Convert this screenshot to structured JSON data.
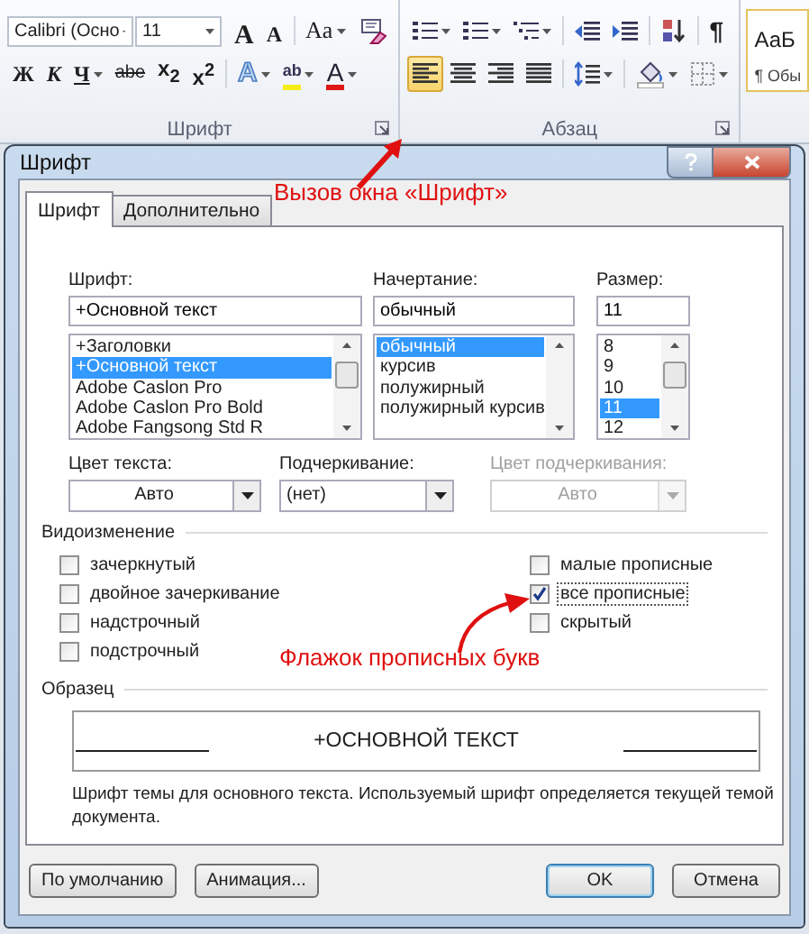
{
  "ribbon": {
    "font_group": {
      "label": "Шрифт",
      "font_name": "Calibri (Осно",
      "font_size": "11",
      "row1": [
        {
          "kind": "grow",
          "label": "A",
          "dropdown": false
        },
        {
          "kind": "shrink",
          "label": "A",
          "dropdown": false
        },
        {
          "kind": "case",
          "label": "Aa",
          "dropdown": true
        },
        {
          "kind": "clear",
          "dropdown": false
        }
      ],
      "row2": [
        {
          "kind": "bold",
          "label": "Ж",
          "dropdown": false
        },
        {
          "kind": "italic",
          "label": "К",
          "dropdown": false
        },
        {
          "kind": "underline",
          "label": "Ч",
          "dropdown": true
        },
        {
          "kind": "strike",
          "label": "abe",
          "dropdown": false
        },
        {
          "kind": "subscript",
          "label": "x$_{2}$",
          "dropdown": false
        },
        {
          "kind": "superscript",
          "label": "x$^{2}$",
          "dropdown": false
        },
        {
          "kind": "effects",
          "label": "A",
          "dropdown": true
        },
        {
          "kind": "highlight",
          "label": "ab",
          "dropdown": true
        },
        {
          "kind": "font-color",
          "label": "A",
          "dropdown": true
        }
      ]
    },
    "paragraph_group": {
      "label": "Абзац",
      "row1": [
        {
          "kind": "bullets",
          "dropdown": true
        },
        {
          "kind": "numbering",
          "dropdown": true
        },
        {
          "kind": "multilevel",
          "dropdown": true
        },
        {
          "kind": "outdent",
          "dropdown": false
        },
        {
          "kind": "indent",
          "dropdown": false
        },
        {
          "kind": "sort",
          "dropdown": false
        },
        {
          "kind": "pilcrow",
          "label": "¶",
          "dropdown": false
        }
      ],
      "row2": [
        {
          "kind": "align-left",
          "selected": true,
          "dropdown": false
        },
        {
          "kind": "align-center",
          "selected": false,
          "dropdown": false
        },
        {
          "kind": "align-right",
          "selected": false,
          "dropdown": false
        },
        {
          "kind": "justify",
          "selected": false,
          "dropdown": false
        },
        {
          "kind": "line-spacing",
          "selected": false,
          "dropdown": true
        },
        {
          "kind": "shading",
          "selected": false,
          "dropdown": true
        },
        {
          "kind": "borders",
          "selected": false,
          "dropdown": true
        }
      ]
    },
    "styles": {
      "sample": "АаБ",
      "name": "¶ Обы"
    }
  },
  "annotations": [
    {
      "kind": "top",
      "text": "Вызов окна «Шрифт»"
    },
    {
      "kind": "checkbox",
      "text": "Флажок прописных букв"
    }
  ],
  "dialog": {
    "title": "Шрифт",
    "tabs": [
      {
        "label": "Шрифт",
        "selected": true
      },
      {
        "label": "Дополнительно",
        "selected": false
      }
    ],
    "font": {
      "label": "Шрифт:",
      "value": "+Основной текст",
      "items": [
        {
          "text": "+Заголовки",
          "selected": false
        },
        {
          "text": "+Основной текст",
          "selected": true
        },
        {
          "text": "Adobe Caslon Pro",
          "selected": false
        },
        {
          "text": "Adobe Caslon Pro Bold",
          "selected": false
        },
        {
          "text": "Adobe Fangsong Std R",
          "selected": false
        }
      ]
    },
    "style": {
      "label": "Начертание:",
      "value": "обычный",
      "items": [
        {
          "text": "обычный",
          "selected": true
        },
        {
          "text": "курсив",
          "selected": false
        },
        {
          "text": "полужирный",
          "selected": false
        },
        {
          "text": "полужирный курсив",
          "selected": false
        }
      ]
    },
    "size": {
      "label": "Размер:",
      "value": "11",
      "items": [
        {
          "text": "8",
          "selected": false
        },
        {
          "text": "9",
          "selected": false
        },
        {
          "text": "10",
          "selected": false
        },
        {
          "text": "11",
          "selected": true
        },
        {
          "text": "12",
          "selected": false
        }
      ]
    },
    "dropdowns": [
      {
        "label": "Цвет текста:",
        "value": "Авто",
        "disabled": false,
        "centered": true
      },
      {
        "label": "Подчеркивание:",
        "value": "(нет)",
        "disabled": false,
        "centered": false
      },
      {
        "label": "Цвет подчеркивания:",
        "value": "Авто",
        "disabled": true,
        "centered": true
      }
    ],
    "effects_title": "Видоизменение",
    "effects_left": [
      {
        "label": "зачеркнутый",
        "checked": false,
        "focused": false
      },
      {
        "label": "двойное зачеркивание",
        "checked": false,
        "focused": false
      },
      {
        "label": "надстрочный",
        "checked": false,
        "focused": false
      },
      {
        "label": "подстрочный",
        "checked": false,
        "focused": false
      }
    ],
    "effects_right": [
      {
        "label": "малые прописные",
        "checked": false,
        "focused": false
      },
      {
        "label": "все прописные",
        "checked": true,
        "focused": true
      },
      {
        "label": "скрытый",
        "checked": false,
        "focused": false
      }
    ],
    "preview_title": "Образец",
    "preview_text": "+ОСНОВНОЙ ТЕКСТ",
    "description": "Шрифт темы для основного текста. Используемый шрифт определяется текущей темой документа.",
    "buttons": [
      {
        "label": "По умолчанию",
        "default": false
      },
      {
        "label": "Анимация...",
        "default": false
      },
      {
        "label": "OK",
        "default": true
      },
      {
        "label": "Отмена",
        "default": false
      }
    ]
  }
}
